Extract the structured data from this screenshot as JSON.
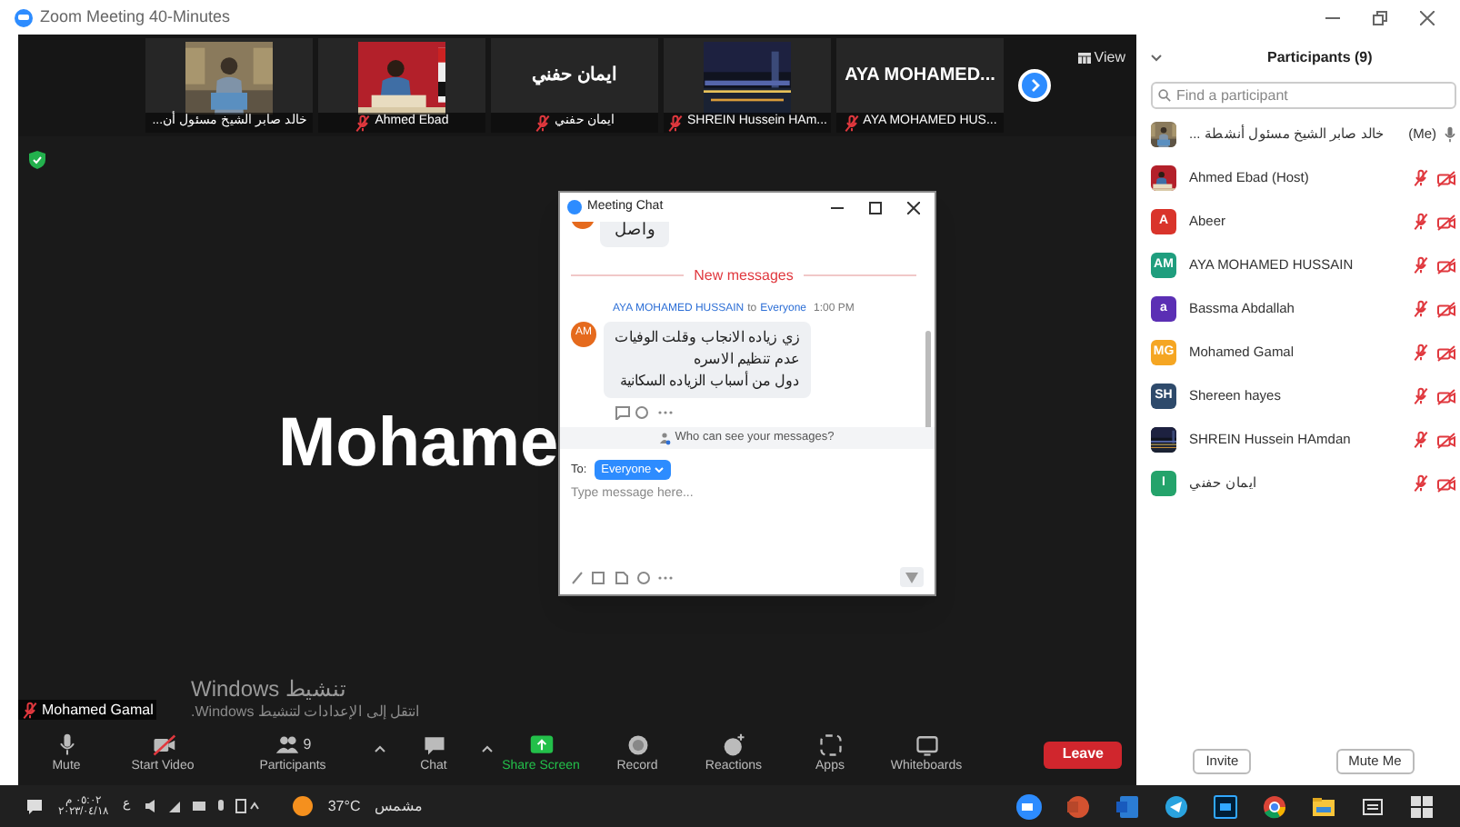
{
  "window": {
    "title": "Zoom Meeting 40-Minutes"
  },
  "thumbnails": [
    {
      "kind": "video",
      "label": "خالد صابر الشيخ مسئول أن...",
      "muted": false
    },
    {
      "kind": "video",
      "label": "Ahmed Ebad",
      "muted": true
    },
    {
      "kind": "name",
      "big_name": "ايمان حفني",
      "label": "ايمان حفني",
      "muted": true
    },
    {
      "kind": "video",
      "label": "SHREIN Hussein HAm...",
      "muted": true
    },
    {
      "kind": "name",
      "big_name": "AYA  MOHAMED...",
      "label": "AYA MOHAMED HUS...",
      "muted": true
    }
  ],
  "view_button": "View",
  "main_video": {
    "big_name": "Mohame",
    "name_tag": "Mohamed Gamal",
    "muted": true
  },
  "activation_notice": {
    "title": "تنشيط Windows",
    "hint": "انتقل إلى الإعدادات لتنشيط Windows."
  },
  "chat": {
    "title": "Meeting Chat",
    "earlier_message": "واصل",
    "divider": "New messages",
    "message": {
      "avatar": "AM",
      "sender": "AYA MOHAMED HUSSAIN",
      "to": "to",
      "recipient": "Everyone",
      "time": "1:00 PM",
      "lines": [
        "زي زياده الانجاب وقلت الوفيات",
        "عدم تنظيم الاسره",
        "دول من أسباب الزياده السكانية"
      ]
    },
    "privacy_notice": "Who can see your messages?",
    "to_label": "To:",
    "recipient_button": "Everyone",
    "placeholder": "Type message here..."
  },
  "participants": {
    "title": "Participants (9)",
    "search_placeholder": "Find a participant",
    "list": [
      {
        "name": "خالد صابر الشيخ مسئول أنشطة ...",
        "suffix": "(Me)",
        "muted": false,
        "video_off": false
      },
      {
        "name": "Ahmed Ebad (Host)",
        "muted": true,
        "video_off": true
      },
      {
        "kind": "initials",
        "name": "Abeer",
        "initials": "A",
        "color": "#d9342b",
        "muted": true,
        "video_off": true
      },
      {
        "kind": "initials",
        "name": "AYA MOHAMED HUSSAIN",
        "initials": "AM",
        "color": "#1f9e7e",
        "muted": true,
        "video_off": true
      },
      {
        "kind": "initials",
        "name": "Bassma Abdallah",
        "initials": "a",
        "color": "#5b2fb4",
        "muted": true,
        "video_off": true
      },
      {
        "kind": "initials",
        "name": "Mohamed Gamal",
        "initials": "MG",
        "color": "#f5a623",
        "muted": true,
        "video_off": true
      },
      {
        "kind": "initials",
        "name": "Shereen hayes",
        "initials": "SH",
        "color": "#2e4a6b",
        "muted": true,
        "video_off": true
      },
      {
        "name": "SHREIN Hussein HAmdan",
        "muted": true,
        "video_off": true
      },
      {
        "kind": "initials",
        "name": "ايمان حفني",
        "initials": "I",
        "color": "#24a36b",
        "muted": true,
        "video_off": true
      }
    ],
    "buttons": [
      "Invite",
      "Mute Me"
    ]
  },
  "toolbar": [
    {
      "kind": "mic",
      "label": "Mute"
    },
    {
      "kind": "video",
      "label": "Start Video"
    },
    {
      "kind": "participants",
      "label": "Participants",
      "count": "9"
    },
    {
      "kind": "chat",
      "label": "Chat"
    },
    {
      "kind": "share",
      "label": "Share Screen"
    },
    {
      "kind": "record",
      "label": "Record"
    },
    {
      "kind": "reactions",
      "label": "Reactions"
    },
    {
      "kind": "apps",
      "label": "Apps"
    },
    {
      "kind": "whiteboards",
      "label": "Whiteboards"
    }
  ],
  "leave_button": "Leave",
  "taskbar": {
    "time": "٠٥:٠٢ م",
    "date": "٢٠٢٣/٠٤/١٨",
    "language": "ع",
    "temperature": "37°C",
    "weather": "مشمس"
  }
}
